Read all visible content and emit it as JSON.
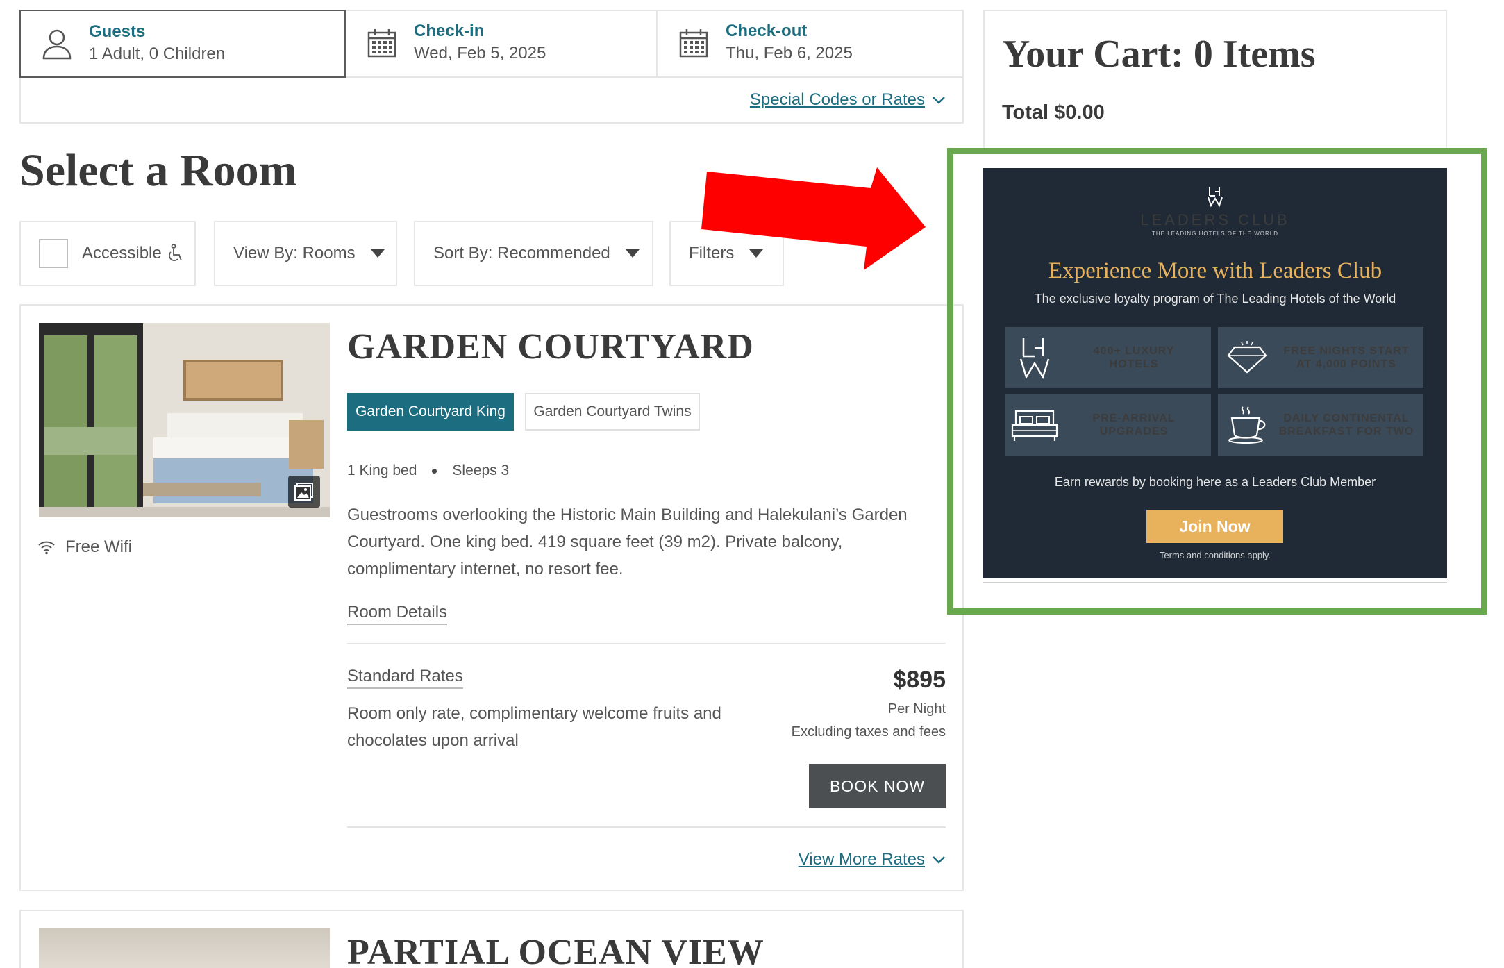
{
  "search": {
    "guests_label": "Guests",
    "guests_value": "1 Adult, 0 Children",
    "checkin_label": "Check-in",
    "checkin_value": "Wed, Feb 5, 2025",
    "checkout_label": "Check-out",
    "checkout_value": "Thu, Feb 6, 2025",
    "special_codes": "Special Codes or Rates"
  },
  "page": {
    "title": "Select a Room"
  },
  "filters": {
    "accessible": "Accessible",
    "view_by": "View By: Rooms",
    "sort_by": "Sort By: Recommended",
    "filters": "Filters"
  },
  "room": {
    "name": "GARDEN COURTYARD",
    "tabs": [
      "Garden Courtyard King",
      "Garden Courtyard Twins"
    ],
    "bed": "1 King bed",
    "sleeps": "Sleeps 3",
    "description": "Guestrooms overlooking the Historic Main Building and Halekulani’s Garden Courtyard. One king bed. 419 square feet (39 m2). Private balcony, complimentary internet, no resort fee.",
    "details_link": "Room Details",
    "amenity": "Free Wifi",
    "rate": {
      "title": "Standard Rates",
      "description": "Room only rate, complimentary welcome fruits and chocolates upon arrival",
      "price": "$895",
      "per_night": "Per Night",
      "excluding": "Excluding taxes and fees",
      "book": "BOOK NOW"
    },
    "more_rates": "View More Rates"
  },
  "room2": {
    "name": "PARTIAL OCEAN VIEW"
  },
  "cart": {
    "title": "Your Cart: 0 Items",
    "total": "Total $0.00"
  },
  "ad": {
    "brand": "LEADERS CLUB",
    "tagline": "THE LEADING HOTELS OF THE WORLD",
    "headline": "Experience More with Leaders Club",
    "subtitle": "The exclusive loyalty program of The Leading Hotels of the World",
    "benefits": [
      {
        "line1": "400+ LUXURY",
        "line2": "HOTELS"
      },
      {
        "line1": "FREE NIGHTS START",
        "line2": "AT 4,000 POINTS"
      },
      {
        "line1": "PRE-ARRIVAL",
        "line2": "UPGRADES"
      },
      {
        "line1": "DAILY CONTINENTAL",
        "line2": "BREAKFAST FOR TWO"
      }
    ],
    "earn": "Earn rewards by booking here as a Leaders Club Member",
    "join": "Join Now",
    "terms": "Terms and conditions apply."
  },
  "colors": {
    "accent_teal": "#1d6d80",
    "ad_background": "#1f2a36",
    "ad_gold": "#e8b15b",
    "highlight_green": "#6aa84f",
    "arrow_red": "#ff0000"
  }
}
